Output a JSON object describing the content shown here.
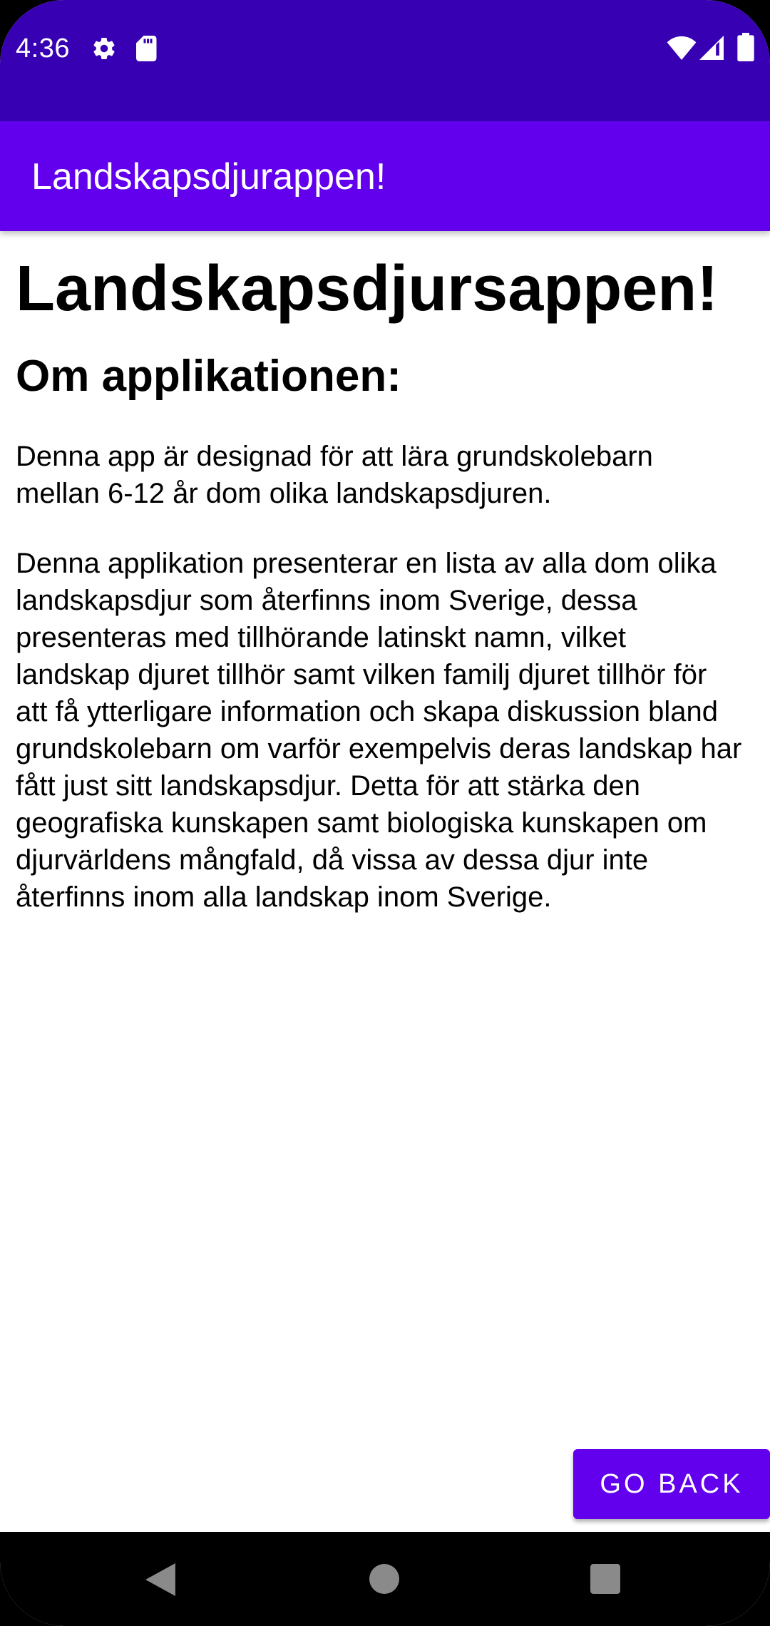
{
  "status_bar": {
    "time": "4:36",
    "icons": [
      "gear-icon",
      "sd-card-icon",
      "wifi-icon",
      "cell-signal-icon",
      "battery-icon"
    ],
    "color": "#3700B3"
  },
  "app_bar": {
    "title": "Landskapsdjurappen!",
    "color": "#6200EE"
  },
  "main": {
    "heading": "Landskapsdjursappen!",
    "subheading": "Om applikationen:",
    "paragraphs": [
      "Denna app är designad för att lära grundskolebarn mellan 6-12 år dom olika landskapsdjuren.",
      "Denna applikation presenterar en lista av alla dom olika landskapsdjur som återfinns inom Sverige, dessa presenteras med tillhörande latinskt namn, vilket landskap djuret tillhör samt vilken familj djuret tillhör för att få ytterligare information och skapa diskussion bland grundskolebarn om varför exempelvis deras landskap har fått just sitt landskapsdjur. Detta för att stärka den geografiska kunskapen samt biologiska kunskapen om djurvärldens mångfald, då vissa av dessa djur inte återfinns inom alla landskap inom Sverige."
    ]
  },
  "actions": {
    "go_back_label": "GO BACK",
    "accent": "#6200EE"
  },
  "nav_bar": {
    "buttons": [
      "back-icon",
      "home-icon",
      "recents-icon"
    ]
  }
}
